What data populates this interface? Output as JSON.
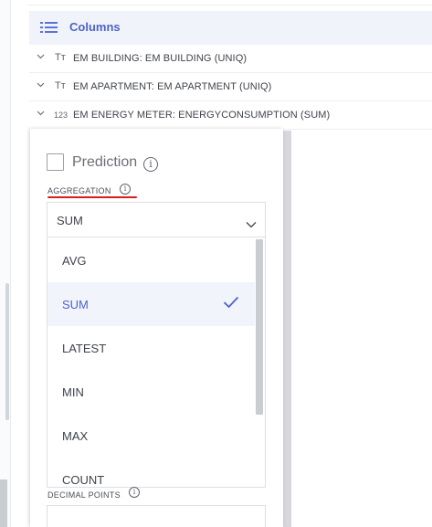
{
  "columns_panel": {
    "title": "Columns",
    "rows": [
      {
        "type_icon": "Tт",
        "label": "EM BUILDING: EM BUILDING (UNIQ)"
      },
      {
        "type_icon": "Tт",
        "label": "EM APARTMENT: EM APARTMENT (UNIQ)"
      },
      {
        "type_icon": "123",
        "label": "EM ENERGY METER: ENERGYCONSUMPTION (SUM)"
      }
    ]
  },
  "popup": {
    "prediction_label": "Prediction",
    "prediction_checked": false,
    "info_glyph": "i",
    "aggregation_label": "AGGREGATION",
    "aggregation_selected": "SUM",
    "aggregation_options": [
      "AVG",
      "SUM",
      "LATEST",
      "MIN",
      "MAX",
      "COUNT"
    ],
    "decimal_points_label": "DECIMAL POINTS"
  },
  "colors": {
    "accent": "#4c62c9",
    "annotation_underline": "#d81e1e"
  },
  "icons": {
    "columns_header": "list-icon",
    "row_toggle": "chevron-down-icon",
    "select_caret": "chevron-down-icon",
    "selected_option": "checkmark-icon",
    "info": "info-icon"
  }
}
